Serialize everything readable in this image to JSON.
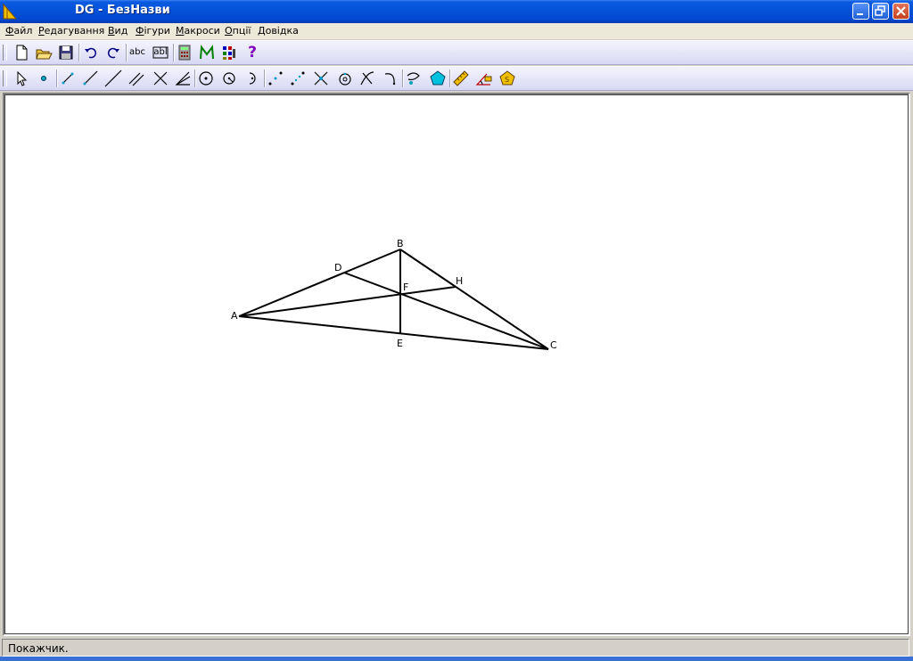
{
  "window": {
    "title": "DG - БезНазви"
  },
  "menu": {
    "items": [
      {
        "label_ul": "Ф",
        "label_rest": "айл"
      },
      {
        "label_ul": "Р",
        "label_rest": "едагування"
      },
      {
        "label_ul": "В",
        "label_rest": "ид"
      },
      {
        "label_ul": "Ф",
        "label_rest": "ігури"
      },
      {
        "label_ul": "М",
        "label_rest": "акроси"
      },
      {
        "label_ul": "О",
        "label_rest": "пції"
      },
      {
        "label_ul": "Д",
        "label_rest": "овідка"
      }
    ]
  },
  "toolbar1": {
    "text_abc": "abc",
    "text_abl": "abl",
    "help": "?"
  },
  "icons": [
    "new-file-icon",
    "open-folder-icon",
    "save-icon",
    "undo-icon",
    "redo-icon",
    "text-abc-icon",
    "text-field-icon",
    "calculator-icon",
    "macro-m-icon",
    "grid-icon",
    "help-question-icon",
    "pointer-icon",
    "point-icon",
    "segment-icon",
    "ray-icon",
    "line-icon",
    "parallel-icon",
    "perpendicular-icon",
    "angle-bisector-icon",
    "circle-icon",
    "circle-radius-icon",
    "arc-icon",
    "midpoint-icon",
    "divide-icon",
    "intersection-icon",
    "concentric-icon",
    "reflect-icon",
    "rotate-icon",
    "locus-icon",
    "polygon-icon",
    "measure-icon",
    "measure-angle-icon",
    "area-icon"
  ],
  "colors": {
    "titlebar": "#0653da",
    "polygon_fill": "#00c0e0",
    "area_fill": "#f0c000",
    "help": "#8000c0"
  },
  "figure": {
    "points": [
      {
        "name": "A"
      },
      {
        "name": "B"
      },
      {
        "name": "C"
      },
      {
        "name": "D"
      },
      {
        "name": "E"
      },
      {
        "name": "F"
      },
      {
        "name": "H"
      }
    ]
  },
  "status": {
    "text": "Покажчик."
  }
}
